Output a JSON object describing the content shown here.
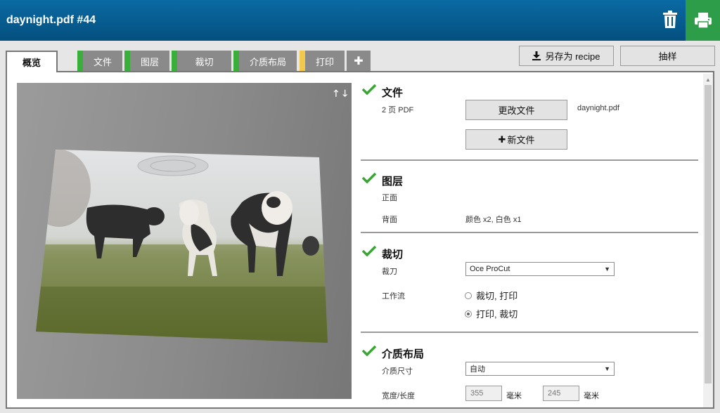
{
  "header": {
    "title": "daynight.pdf #44"
  },
  "tabs": [
    {
      "label": "概览"
    },
    {
      "label": "文件"
    },
    {
      "label": "图层"
    },
    {
      "label": "裁切"
    },
    {
      "label": "介质布局"
    },
    {
      "label": "打印"
    },
    {
      "label": "✚"
    }
  ],
  "actions": {
    "save_recipe": "另存为 recipe",
    "sample": "抽样"
  },
  "colors": {
    "header": "#04507f",
    "print_button": "#2e9d4a",
    "tab_ok": "#3aae3a",
    "tab_warning": "#f2c94c",
    "check": "#3aa535"
  },
  "sections": {
    "file": {
      "title": "文件",
      "pages": "2 页 PDF",
      "change_file": "更改文件",
      "new_file": "新文件",
      "filename": "daynight.pdf"
    },
    "layers": {
      "title": "图层",
      "front_label": "正面",
      "back_label": "背面",
      "back_value": "颜色 x2, 白色 x1"
    },
    "cut": {
      "title": "裁切",
      "cutter_label": "裁刀",
      "cutter_value": "Oce ProCut",
      "workflow_label": "工作流",
      "workflow_options": [
        "裁切, 打印",
        "打印, 裁切"
      ],
      "workflow_selected": 1
    },
    "media": {
      "title": "介质布局",
      "size_label": "介质尺寸",
      "size_value": "自动",
      "wl_label": "宽度/长度",
      "width": "355",
      "length": "245",
      "unit": "毫米"
    }
  }
}
